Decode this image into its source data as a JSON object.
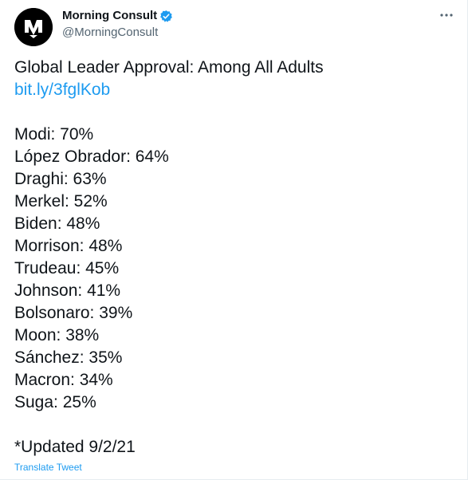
{
  "author": {
    "display_name": "Morning Consult",
    "handle": "@MorningConsult",
    "verified": true,
    "avatar_icon": "morning-consult-logo-icon",
    "avatar_bg": "#000000"
  },
  "menu_icon": "more-options-icon",
  "tweet": {
    "title": "Global Leader Approval: Among All Adults",
    "link": "bit.ly/3fglKob",
    "approvals": [
      {
        "text": "Modi: 70%"
      },
      {
        "text": "López Obrador: 64%"
      },
      {
        "text": "Draghi: 63%"
      },
      {
        "text": "Merkel: 52%"
      },
      {
        "text": "Biden: 48%"
      },
      {
        "text": "Morrison: 48%"
      },
      {
        "text": "Trudeau: 45%"
      },
      {
        "text": "Johnson: 41%"
      },
      {
        "text": "Bolsonaro: 39%"
      },
      {
        "text": "Moon: 38%"
      },
      {
        "text": "Sánchez: 35%"
      },
      {
        "text": "Macron: 34%"
      },
      {
        "text": "Suga: 25%"
      }
    ],
    "footnote": "*Updated 9/2/21"
  },
  "translate_label": "Translate Tweet",
  "colors": {
    "text": "#0f1419",
    "secondary": "#536471",
    "link": "#1d9bf0",
    "verified_badge": "#1d9bf0"
  }
}
